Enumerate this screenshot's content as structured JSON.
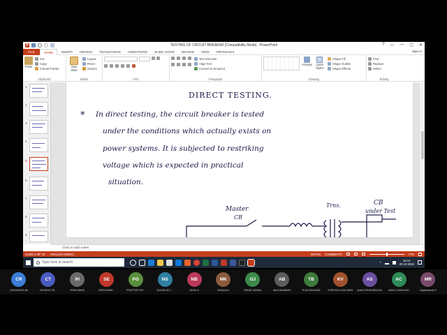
{
  "window": {
    "title": "TESTING OF CIRCUIT BREAKER [Compatibility Mode] - PowerPoint",
    "controls": [
      "?",
      "▭",
      "—",
      "▢",
      "✕"
    ],
    "sign_in": "Sign in"
  },
  "tabs": [
    "FILE",
    "HOME",
    "INSERT",
    "DESIGN",
    "TRANSITIONS",
    "ANIMATIONS",
    "SLIDE SHOW",
    "REVIEW",
    "VIEW",
    "PDFelement"
  ],
  "active_tab": "HOME",
  "ribbon": {
    "clipboard": {
      "paste": "Paste",
      "cut": "Cut",
      "copy": "Copy",
      "format_painter": "Format Painter",
      "label": "Clipboard"
    },
    "slides": {
      "new_slide": "New Slide",
      "layout": "Layout",
      "reset": "Reset",
      "section": "Section",
      "label": "Slides"
    },
    "font": {
      "label": "Font"
    },
    "paragraph": {
      "text_direction": "Text Direction",
      "align_text": "Align Text",
      "smartart": "Convert to SmartArt",
      "label": "Paragraph"
    },
    "drawing": {
      "arrange": "Arrange",
      "quick_styles": "Quick Styles",
      "shape_fill": "Shape Fill",
      "shape_outline": "Shape Outline",
      "shape_effects": "Shape Effects",
      "label": "Drawing"
    },
    "editing": {
      "find": "Find",
      "replace": "Replace",
      "select": "Select",
      "label": "Editing"
    }
  },
  "slide_thumbnails": [
    "1",
    "2",
    "3",
    "4",
    "5",
    "6",
    "7",
    "8",
    "9"
  ],
  "selected_slide": 5,
  "slide": {
    "heading": "DIRECT TESTING.",
    "bullet": "*",
    "lines": [
      "In direct testing, the circuit breaker is tested",
      "under the conditions which actually exists on",
      "power systems. It is subjected to restriking",
      "voltage which is expected in practical",
      "situation."
    ],
    "diagram": {
      "master": "Master",
      "cb": "CB",
      "trans": "Trns.",
      "cb_test": "CB",
      "under_test": "under Test"
    }
  },
  "notes_placeholder": "Click to add notes",
  "status": {
    "slide_of": "SLIDE 5 OF 10",
    "language": "ENGLISH (INDIA)",
    "notes": "NOTES",
    "comments": "COMMENTS",
    "zoom": "77%"
  },
  "taskbar": {
    "search_placeholder": "Type here to search",
    "time": "16:14",
    "date": "20-10-2020"
  },
  "participants": [
    {
      "initials": "CR",
      "name": "CHIRANJEEVI BA",
      "color": "#3b7dd8"
    },
    {
      "initials": "CT",
      "name": "CHITANYA TRI...",
      "color": "#4a5bc0"
    },
    {
      "initials": "IH",
      "name": "IRFAN HAMID",
      "color": "#6a6a6a"
    },
    {
      "initials": "SE",
      "name": "SREEKUMAR...",
      "color": "#c0392b"
    },
    {
      "initials": "PG",
      "name": "PRAPTOSH KRI...",
      "color": "#5a8f3c"
    },
    {
      "initials": "NS",
      "name": "NILADRI SE C...",
      "color": "#2f7fa0"
    },
    {
      "initials": "NB",
      "name": "NIKHIL B",
      "color": "#b83a5a"
    },
    {
      "initials": "MK",
      "name": "MONAGA K",
      "color": "#8a5a3c"
    },
    {
      "initials": "OJ",
      "name": "OMKAR JAISWAL",
      "color": "#3c8a4a"
    },
    {
      "initials": "AB",
      "name": "ANUJ BHANDARI",
      "color": "#5c5c5c"
    },
    {
      "initials": "TB",
      "name": "TEJAS BHAGWAT",
      "color": "#3d7a3d"
    },
    {
      "initials": "KV",
      "name": "KORIVPELLA SAI VARSH",
      "color": "#a0522d"
    },
    {
      "initials": "AS",
      "name": "ANANT DEVENDRA SAXENA",
      "color": "#6b4fa0"
    },
    {
      "initials": "AC",
      "name": "AMAN CHAUDHARY",
      "color": "#2e8b57"
    },
    {
      "initials": "MR",
      "name": "Mageshwaran R",
      "color": "#7a4a6a"
    }
  ]
}
